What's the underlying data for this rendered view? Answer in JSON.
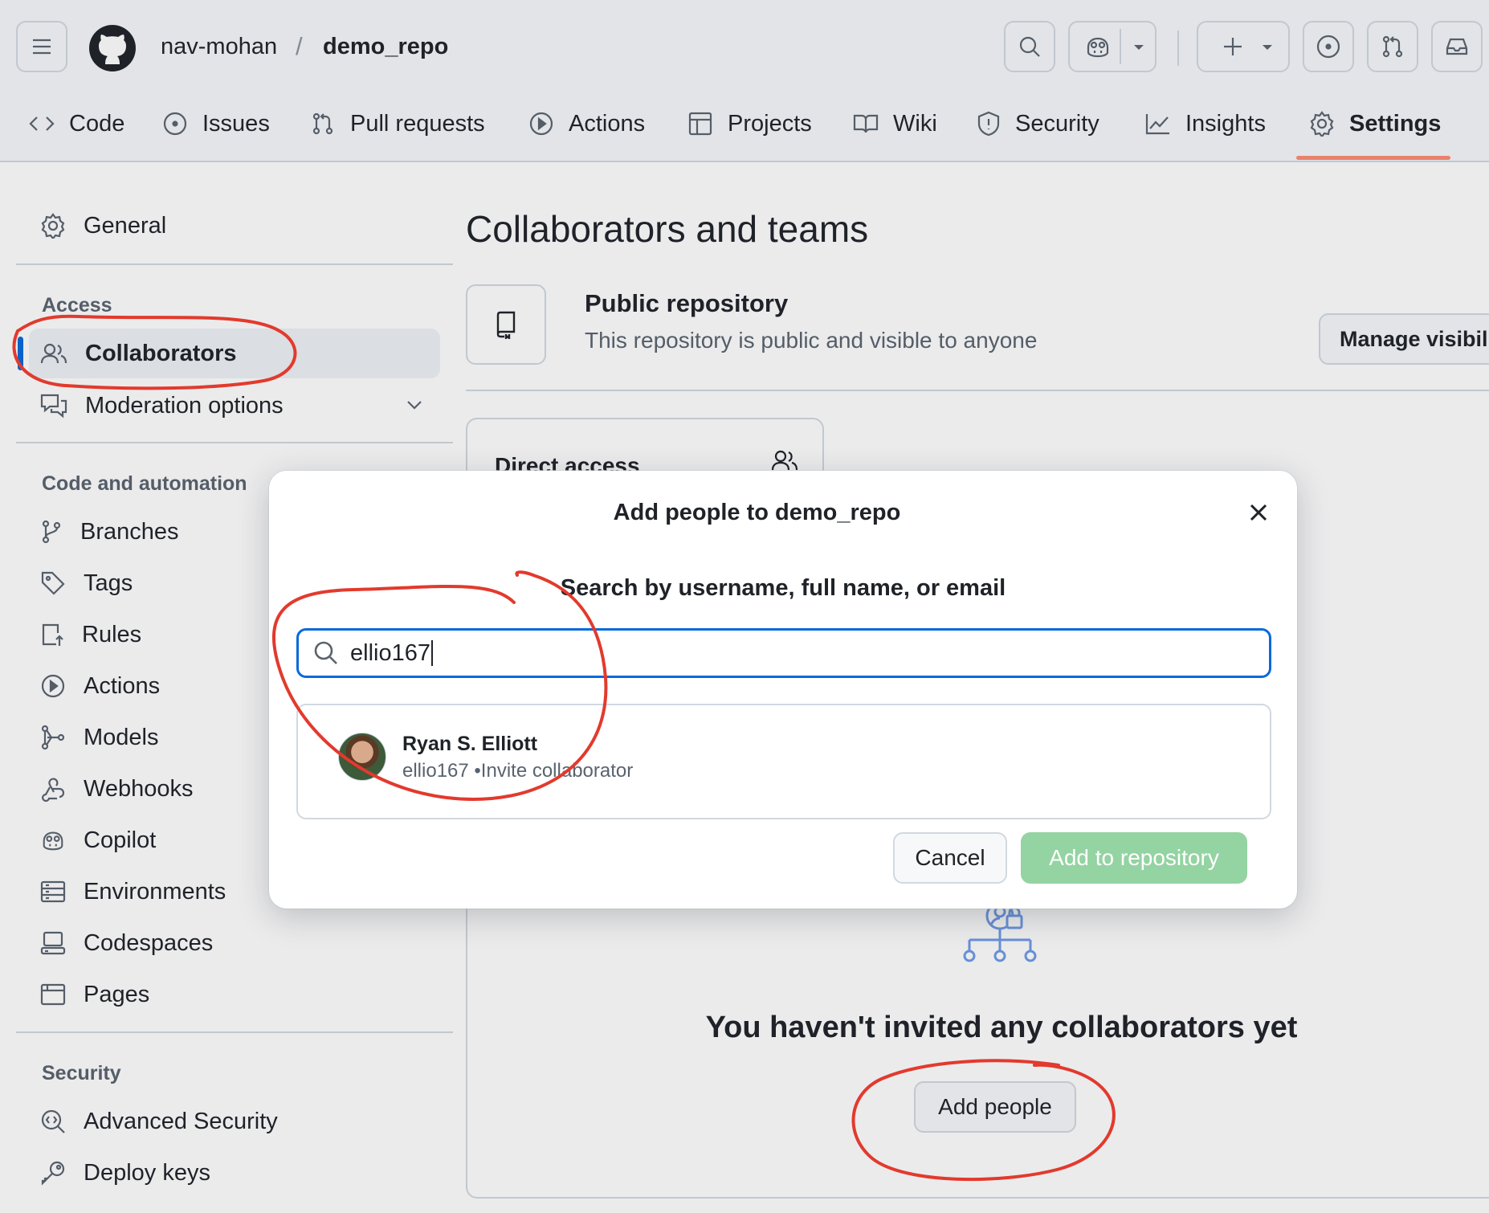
{
  "header": {
    "owner": "nav-mohan",
    "separator": "/",
    "repo": "demo_repo",
    "buttons": [
      "menu-icon",
      "search-icon",
      "copilot-icon",
      "plus-icon",
      "issues-icon",
      "pull-request-icon",
      "inbox-icon"
    ]
  },
  "tabs": [
    {
      "label": "Code",
      "icon": "code-icon"
    },
    {
      "label": "Issues",
      "icon": "issue-icon"
    },
    {
      "label": "Pull requests",
      "icon": "pull-request-icon"
    },
    {
      "label": "Actions",
      "icon": "play-icon"
    },
    {
      "label": "Projects",
      "icon": "table-icon"
    },
    {
      "label": "Wiki",
      "icon": "book-icon"
    },
    {
      "label": "Security",
      "icon": "shield-icon"
    },
    {
      "label": "Insights",
      "icon": "graph-icon"
    },
    {
      "label": "Settings",
      "icon": "gear-icon",
      "active": true
    }
  ],
  "sidebar": {
    "general": "General",
    "access_heading": "Access",
    "collaborators": "Collaborators",
    "moderation": "Moderation options",
    "code_heading": "Code and automation",
    "code_items": [
      "Branches",
      "Tags",
      "Rules",
      "Actions",
      "Models",
      "Webhooks",
      "Copilot",
      "Environments",
      "Codespaces",
      "Pages"
    ],
    "security_heading": "Security",
    "security_items": [
      "Advanced Security",
      "Deploy keys"
    ]
  },
  "main": {
    "title": "Collaborators and teams",
    "visibility_title": "Public repository",
    "visibility_desc": "This repository is public and visible to anyone",
    "manage_button": "Manage visibil",
    "direct_access": "Direct access",
    "empty_text": "You haven't invited any collaborators yet",
    "add_people": "Add people"
  },
  "dialog": {
    "title": "Add people to demo_repo",
    "subtitle": "Search by username, full name, or email",
    "search_value": "ellio167",
    "result_name": "Ryan S. Elliott",
    "result_meta": "ellio167 •Invite collaborator",
    "cancel": "Cancel",
    "add": "Add to repository"
  },
  "colors": {
    "accent": "#0969da",
    "add_button_disabled": "#94d3a2",
    "annotation": "#e23a2d",
    "tab_underline": "#fd8c73"
  }
}
